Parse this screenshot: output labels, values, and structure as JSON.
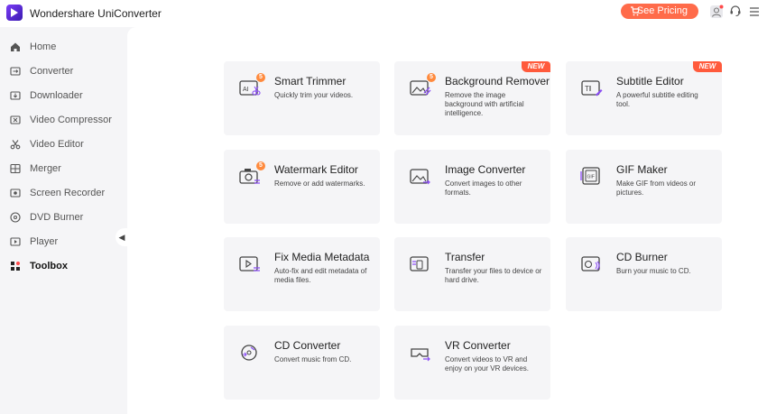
{
  "app": {
    "title": "Wondershare UniConverter"
  },
  "header": {
    "pricing_label": "See Pricing"
  },
  "sidebar": {
    "items": [
      {
        "label": "Home",
        "icon": "home-icon"
      },
      {
        "label": "Converter",
        "icon": "converter-icon"
      },
      {
        "label": "Downloader",
        "icon": "downloader-icon"
      },
      {
        "label": "Video Compressor",
        "icon": "compressor-icon"
      },
      {
        "label": "Video Editor",
        "icon": "scissors-icon"
      },
      {
        "label": "Merger",
        "icon": "merger-icon"
      },
      {
        "label": "Screen Recorder",
        "icon": "screen-recorder-icon"
      },
      {
        "label": "DVD Burner",
        "icon": "disc-icon"
      },
      {
        "label": "Player",
        "icon": "player-icon"
      },
      {
        "label": "Toolbox",
        "icon": "toolbox-icon",
        "active": true
      }
    ]
  },
  "tools": [
    {
      "title": "Smart Trimmer",
      "desc": "Quickly trim your videos.",
      "badge": "5",
      "new": ""
    },
    {
      "title": "Background Remover",
      "desc": "Remove the image background with artificial intelligence.",
      "badge": "5",
      "new": "NEW"
    },
    {
      "title": "Subtitle Editor",
      "desc": "A powerful subtitle editing tool.",
      "badge": "",
      "new": "NEW"
    },
    {
      "title": "Watermark Editor",
      "desc": "Remove or add watermarks.",
      "badge": "5",
      "new": ""
    },
    {
      "title": "Image Converter",
      "desc": "Convert images to other formats.",
      "badge": "",
      "new": ""
    },
    {
      "title": "GIF Maker",
      "desc": "Make GIF from videos or pictures.",
      "badge": "",
      "new": ""
    },
    {
      "title": "Fix Media Metadata",
      "desc": "Auto-fix and edit metadata of media files.",
      "badge": "",
      "new": ""
    },
    {
      "title": "Transfer",
      "desc": "Transfer your files to device or hard drive.",
      "badge": "",
      "new": ""
    },
    {
      "title": "CD Burner",
      "desc": "Burn your music to CD.",
      "badge": "",
      "new": ""
    },
    {
      "title": "CD Converter",
      "desc": "Convert music from CD.",
      "badge": "",
      "new": ""
    },
    {
      "title": "VR Converter",
      "desc": "Convert videos to VR and enjoy on your VR devices.",
      "badge": "",
      "new": ""
    }
  ],
  "colors": {
    "accent": "#ff6b4a",
    "brand": "#6a2cf0",
    "sidebar_bg": "#f5f5f7",
    "card_bg": "#f5f5f7"
  }
}
